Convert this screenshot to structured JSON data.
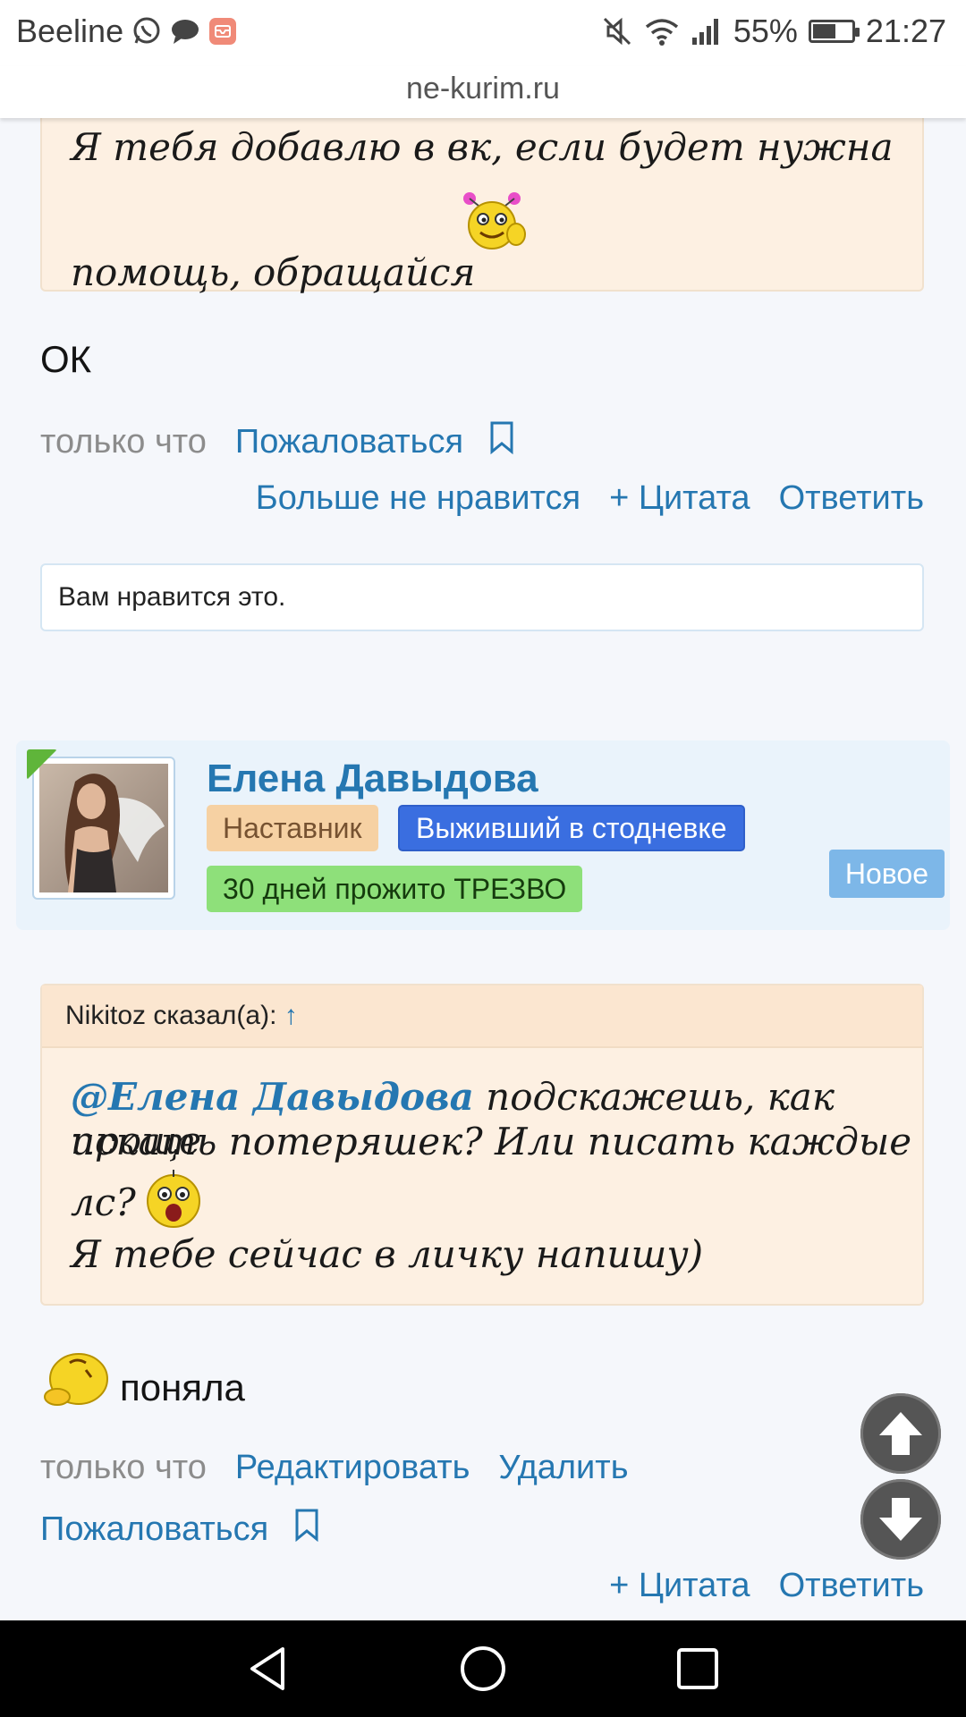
{
  "status_bar": {
    "carrier": "Beeline",
    "battery_percent": "55%",
    "battery_level": 0.55,
    "time": "21:27",
    "icons": [
      "whatsapp-icon",
      "chat-bubble-icon",
      "mail-app-icon",
      "mute-icon",
      "wifi-icon",
      "signal-icon",
      "battery-icon"
    ]
  },
  "browser": {
    "url": "ne-kurim.ru"
  },
  "post1": {
    "quote_line1": "Я тебя добавлю в вк, если будет нужна",
    "quote_line2": "помощь, обращайся",
    "emoji": "thumbs-up-smiley",
    "body": "ОК",
    "time": "только что",
    "report": "Пожаловаться",
    "unlike": "Больше не нравится",
    "quote_action": "+ Цитата",
    "reply": "Ответить",
    "likes": "Вам нравится это."
  },
  "user": {
    "name": "Елена Давыдова",
    "badge_mentor": "Наставник",
    "badge_survivor": "Выживший в стодневке",
    "badge_sober": "30 дней прожито ТРЕЗВО",
    "badge_new": "Новое"
  },
  "post2": {
    "quote_author": "Nikitoz сказал(а):",
    "quote_arrow": "↑",
    "mention": "@Елена Давыдова",
    "quote_line1_rest": " подскажешь, как проще",
    "quote_line2": "искать потеряшек? Или писать каждые",
    "quote_line3": "лс?",
    "quote_line4": "Я тебе сейчас в личку напишу)",
    "emoji_quote": "shocked-smiley",
    "emoji_body": "thinking-smiley",
    "body": "поняла",
    "time": "только что",
    "edit": "Редактировать",
    "delete": "Удалить",
    "report": "Пожаловаться",
    "quote_action": "+ Цитата",
    "reply": "Ответить"
  },
  "colors": {
    "link": "#2577b1",
    "quote_bg": "#fdf0e2",
    "badge_mentor": "#f6d1a3",
    "badge_survivor": "#3a6ee0",
    "badge_sober": "#8ee07a",
    "badge_new": "#7db7e8"
  }
}
